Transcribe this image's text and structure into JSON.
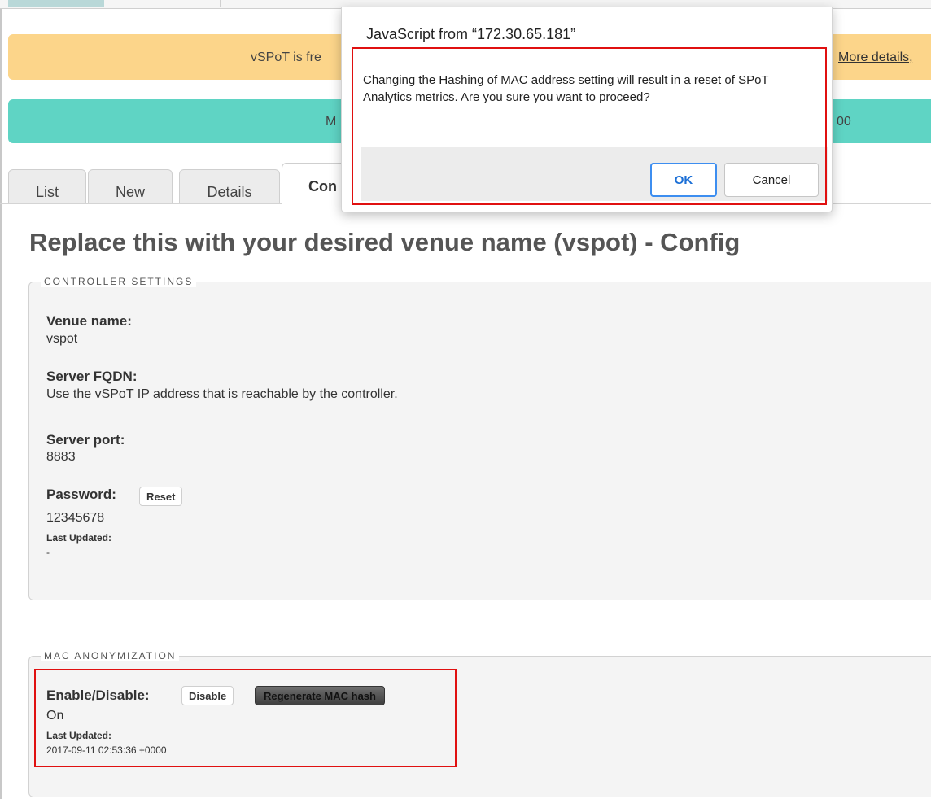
{
  "banners": {
    "yellow_text": "vSPoT is fre",
    "yellow_link": "More details,",
    "teal_text_left": "M",
    "teal_text_right": "00"
  },
  "tabs": [
    {
      "label": "List"
    },
    {
      "label": "New"
    },
    {
      "label": "Details"
    },
    {
      "label": "Con"
    }
  ],
  "page_title": "Replace this with your desired venue name (vspot) - Config",
  "controller": {
    "legend": "CONTROLLER SETTINGS",
    "venue_label": "Venue name:",
    "venue_value": "vspot",
    "fqdn_label": "Server FQDN:",
    "fqdn_value": "Use the vSPoT IP address that is reachable by the controller.",
    "port_label": "Server port:",
    "port_value": "8883",
    "password_label": "Password:",
    "reset_button": "Reset",
    "password_value": "12345678",
    "last_updated_label": "Last Updated:",
    "last_updated_value": "-"
  },
  "mac": {
    "legend": "MAC ANONYMIZATION",
    "enable_label": "Enable/Disable:",
    "disable_button": "Disable",
    "regen_button": "Regenerate MAC hash",
    "status": "On",
    "last_updated_label": "Last Updated:",
    "last_updated_value": "2017-09-11 02:53:36 +0000"
  },
  "dialog": {
    "title": "JavaScript from “172.30.65.181”",
    "message": "Changing the Hashing of MAC address setting will result in a reset of SPoT Analytics metrics. Are you sure you want to proceed?",
    "ok_label": "OK",
    "cancel_label": "Cancel"
  },
  "colors": {
    "highlight": "#e01010",
    "yellow_banner": "#fcd58a",
    "teal_banner": "#5fd4c4",
    "ok_accent": "#3d8ef0"
  }
}
